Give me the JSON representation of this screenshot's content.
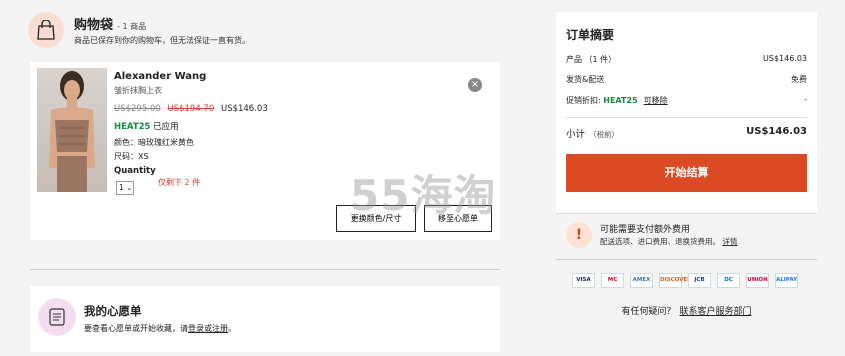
{
  "bag": {
    "title": "购物袋",
    "count": "- 1 商品",
    "note": "商品已保存到你的购物车，但无法保证一直有货。"
  },
  "item": {
    "brand": "Alexander Wang",
    "name": "皱折抹胸上衣",
    "price_original": "US$295.00",
    "price_sale": "US$194.70",
    "price_final": "US$146.03",
    "promo_code": "HEAT25",
    "promo_applied": "已应用",
    "color": "颜色：暗玫瑰红米黄色",
    "size": "尺码：XS",
    "quantity_label": "Quantity",
    "quantity_value": "1",
    "stock_left": "仅剩下 2 件",
    "change_button": "更换颜色/尺寸",
    "wishlist_button": "移至心愿单",
    "remove_icon": "close-icon"
  },
  "wishlist": {
    "title": "我的心愿单",
    "text_prefix": "要查看心愿单或开始收藏，请",
    "link": "登录或注册",
    "text_suffix": "。"
  },
  "summary": {
    "title": "订单摘要",
    "product_label": "产品 （1 件）",
    "product_value": "US$146.03",
    "shipping_label": "发货&配送",
    "shipping_value": "免费",
    "promo_label": "促销折扣: ",
    "promo_code": "HEAT25",
    "promo_remove": "可移除",
    "promo_value": "-",
    "subtotal_label": "小计",
    "subtotal_sub": "（税前）",
    "subtotal_value": "US$146.03",
    "checkout_button": "开始结算"
  },
  "fees": {
    "icon": "!",
    "title": "可能需要支付额外费用",
    "text": "配送选项、进口费用、退换货费用。",
    "link": "详情"
  },
  "payments": [
    "VISA",
    "MC",
    "AMEX",
    "DISCOVER",
    "JCB",
    "DC",
    "UNION",
    "ALIPAY"
  ],
  "help": {
    "question": "有任何疑问？",
    "link": "联系客户服务部门"
  },
  "watermark": "55海淘",
  "colors": {
    "accent": "#db4a22",
    "sale_red": "#d9412e",
    "promo_green": "#1b8a3e"
  }
}
